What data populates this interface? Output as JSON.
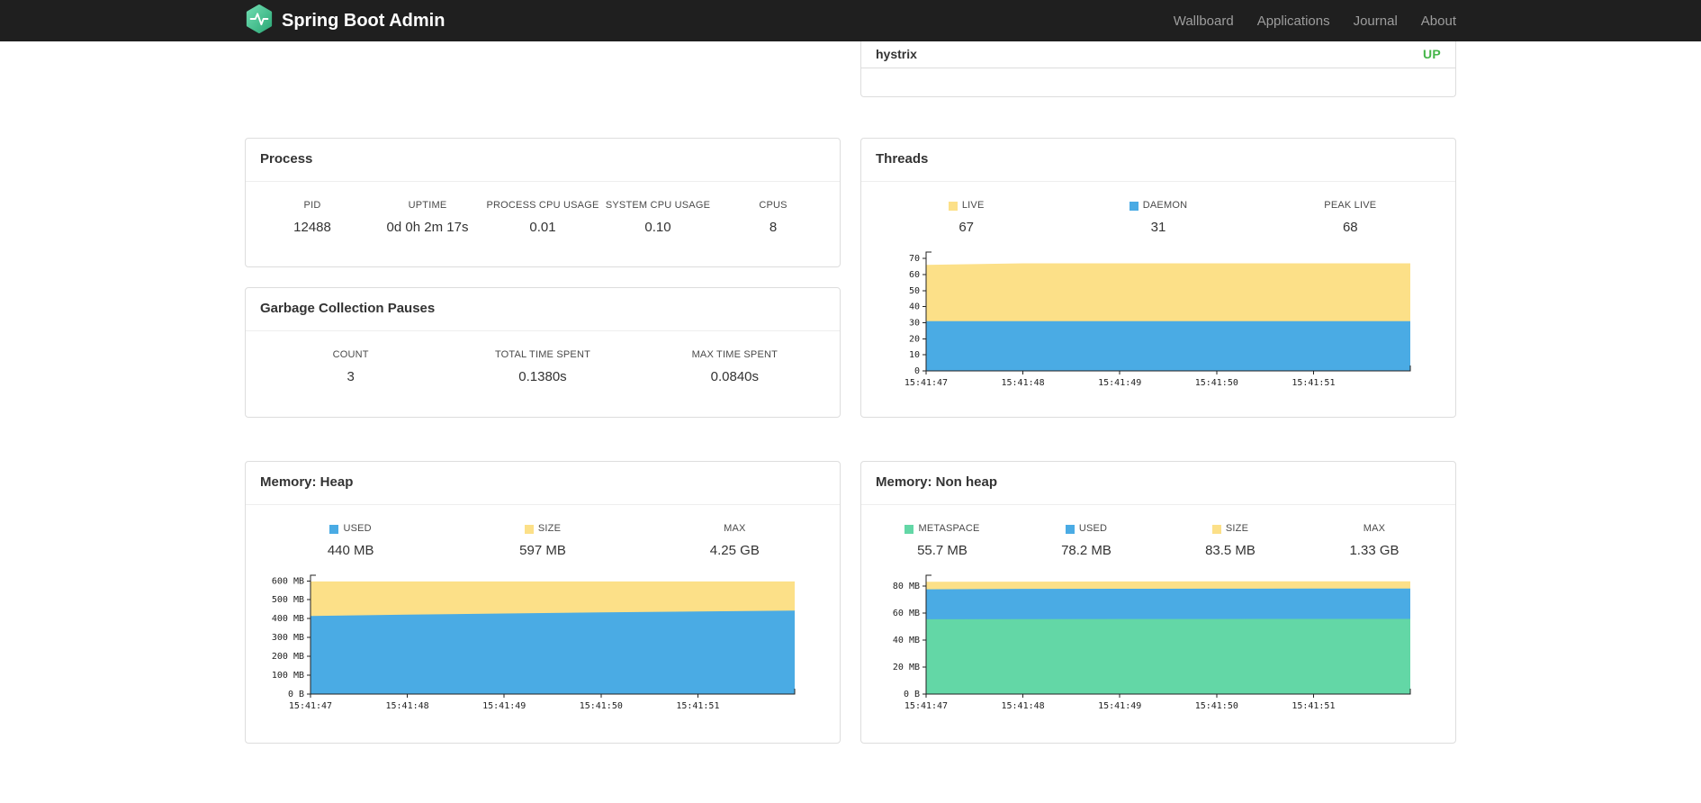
{
  "navbar": {
    "brand": "Spring Boot Admin",
    "links": [
      "Wallboard",
      "Applications",
      "Journal",
      "About"
    ]
  },
  "applications": {
    "rows": [
      {
        "name": "hystrix",
        "status": "UP",
        "status_color": "#45b649"
      }
    ]
  },
  "colors": {
    "yellow": "#fce088",
    "blue": "#4aabe4",
    "green": "#63d7a6",
    "navbar_bg": "#1f1f1f",
    "up_green": "#45b649"
  },
  "cards": {
    "process": {
      "title": "Process",
      "stats": [
        {
          "label": "PID",
          "value": "12488"
        },
        {
          "label": "UPTIME",
          "value": "0d 0h 2m 17s"
        },
        {
          "label": "PROCESS CPU USAGE",
          "value": "0.01"
        },
        {
          "label": "SYSTEM CPU USAGE",
          "value": "0.10"
        },
        {
          "label": "CPUS",
          "value": "8"
        }
      ]
    },
    "gc": {
      "title": "Garbage Collection Pauses",
      "stats": [
        {
          "label": "COUNT",
          "value": "3"
        },
        {
          "label": "TOTAL TIME SPENT",
          "value": "0.1380s"
        },
        {
          "label": "MAX TIME SPENT",
          "value": "0.0840s"
        }
      ]
    },
    "threads": {
      "title": "Threads",
      "stats": [
        {
          "label": "LIVE",
          "value": "67",
          "color": "#fce088"
        },
        {
          "label": "DAEMON",
          "value": "31",
          "color": "#4aabe4"
        },
        {
          "label": "PEAK LIVE",
          "value": "68"
        }
      ]
    },
    "heap": {
      "title": "Memory: Heap",
      "stats": [
        {
          "label": "USED",
          "value": "440 MB",
          "color": "#4aabe4"
        },
        {
          "label": "SIZE",
          "value": "597 MB",
          "color": "#fce088"
        },
        {
          "label": "MAX",
          "value": "4.25 GB"
        }
      ]
    },
    "nonheap": {
      "title": "Memory: Non heap",
      "stats": [
        {
          "label": "METASPACE",
          "value": "55.7 MB",
          "color": "#63d7a6"
        },
        {
          "label": "USED",
          "value": "78.2 MB",
          "color": "#4aabe4"
        },
        {
          "label": "SIZE",
          "value": "83.5 MB",
          "color": "#fce088"
        },
        {
          "label": "MAX",
          "value": "1.33 GB"
        }
      ]
    }
  },
  "chart_data": [
    {
      "type": "area",
      "title": "Threads",
      "x": [
        "15:41:47",
        "15:41:48",
        "15:41:49",
        "15:41:50",
        "15:41:51"
      ],
      "xlabel": "",
      "ylabel": "",
      "ylim": [
        0,
        74
      ],
      "yticks": [
        [
          0,
          "0"
        ],
        [
          10,
          "10"
        ],
        [
          20,
          "20"
        ],
        [
          30,
          "30"
        ],
        [
          40,
          "40"
        ],
        [
          50,
          "50"
        ],
        [
          60,
          "60"
        ],
        [
          70,
          "70"
        ]
      ],
      "legend_position": "top",
      "grid": false,
      "series": [
        {
          "name": "LIVE",
          "color": "#fce088",
          "values": [
            66,
            67,
            67,
            67,
            67,
            67
          ]
        },
        {
          "name": "DAEMON",
          "color": "#4aabe4",
          "values": [
            31,
            31,
            31,
            31,
            31,
            31
          ]
        }
      ]
    },
    {
      "type": "area",
      "title": "Memory: Heap",
      "x": [
        "15:41:47",
        "15:41:48",
        "15:41:49",
        "15:41:50",
        "15:41:51"
      ],
      "xlabel": "",
      "ylabel": "",
      "ylim": [
        0,
        630
      ],
      "yticks": [
        [
          0,
          "0 B"
        ],
        [
          100,
          "100 MB"
        ],
        [
          200,
          "200 MB"
        ],
        [
          300,
          "300 MB"
        ],
        [
          400,
          "400 MB"
        ],
        [
          500,
          "500 MB"
        ],
        [
          600,
          "600 MB"
        ]
      ],
      "legend_position": "top",
      "grid": false,
      "series": [
        {
          "name": "SIZE",
          "color": "#fce088",
          "values": [
            597,
            597,
            597,
            597,
            597,
            597
          ]
        },
        {
          "name": "USED",
          "color": "#4aabe4",
          "values": [
            414,
            421,
            427,
            433,
            438,
            443
          ]
        }
      ]
    },
    {
      "type": "area",
      "title": "Memory: Non heap",
      "x": [
        "15:41:47",
        "15:41:48",
        "15:41:49",
        "15:41:50",
        "15:41:51"
      ],
      "xlabel": "",
      "ylabel": "",
      "ylim": [
        0,
        88
      ],
      "yticks": [
        [
          0,
          "0 B"
        ],
        [
          20,
          "20 MB"
        ],
        [
          40,
          "40 MB"
        ],
        [
          60,
          "60 MB"
        ],
        [
          80,
          "80 MB"
        ]
      ],
      "legend_position": "top",
      "grid": false,
      "series": [
        {
          "name": "SIZE",
          "color": "#fce088",
          "values": [
            83.2,
            83.3,
            83.4,
            83.5,
            83.5,
            83.5
          ]
        },
        {
          "name": "USED",
          "color": "#4aabe4",
          "values": [
            77.6,
            77.9,
            78.0,
            78.1,
            78.2,
            78.2
          ]
        },
        {
          "name": "METASPACE",
          "color": "#63d7a6",
          "values": [
            55.4,
            55.5,
            55.6,
            55.6,
            55.7,
            55.7
          ]
        }
      ]
    }
  ]
}
